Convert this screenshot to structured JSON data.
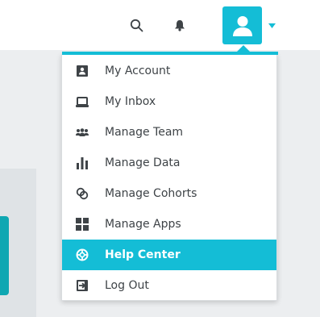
{
  "header": {
    "search_icon": "search-icon",
    "notifications_icon": "bell-icon",
    "avatar_icon": "user-icon",
    "menu_caret_icon": "caret-down-icon"
  },
  "user_menu": {
    "items": [
      {
        "label": "My Account",
        "icon": "account-icon",
        "active": false
      },
      {
        "label": "My Inbox",
        "icon": "inbox-icon",
        "active": false
      },
      {
        "label": "Manage Team",
        "icon": "team-icon",
        "active": false
      },
      {
        "label": "Manage Data",
        "icon": "bar-chart-icon",
        "active": false
      },
      {
        "label": "Manage Cohorts",
        "icon": "cohorts-icon",
        "active": false
      },
      {
        "label": "Manage Apps",
        "icon": "apps-grid-icon",
        "active": false
      },
      {
        "label": "Help Center",
        "icon": "lifebuoy-icon",
        "active": true
      },
      {
        "label": "Log Out",
        "icon": "logout-icon",
        "active": false
      }
    ]
  },
  "colors": {
    "accent": "#14bdd6",
    "text": "#3e4347",
    "background": "#eceef0"
  }
}
